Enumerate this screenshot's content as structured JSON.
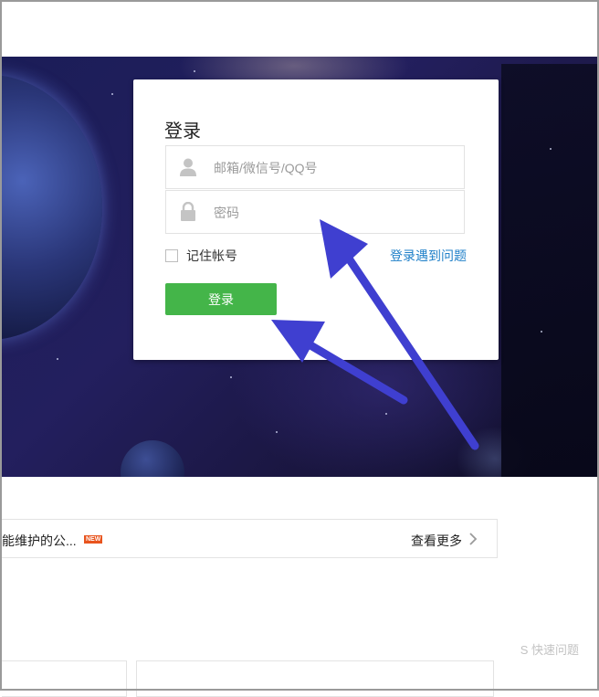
{
  "login": {
    "title": "登录",
    "username_placeholder": "邮箱/微信号/QQ号",
    "password_placeholder": "密码",
    "remember_label": "记住帐号",
    "help_link": "登录遇到问题",
    "submit_label": "登录"
  },
  "notice": {
    "text": "能维护的公...",
    "badge": "NEW",
    "more_label": "查看更多"
  },
  "watermark": "S 快速问题",
  "colors": {
    "accent_green": "#44b549",
    "link_blue": "#1e7fc8",
    "arrow_blue": "#3f3fd0",
    "badge_orange": "#e8541e"
  },
  "icons": [
    "user-icon",
    "lock-icon",
    "chevron-right-icon"
  ]
}
